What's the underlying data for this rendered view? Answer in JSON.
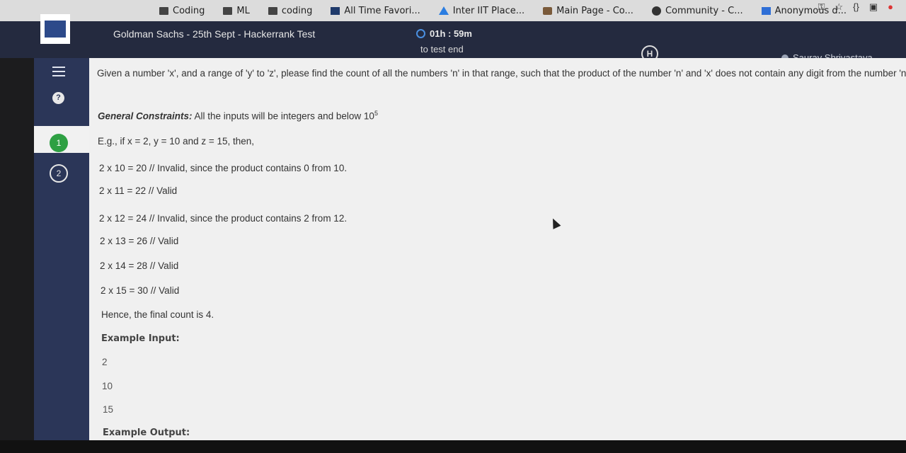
{
  "bookmarks": [
    {
      "label": "Coding",
      "icon": "folder-icon"
    },
    {
      "label": "ML",
      "icon": "folder-icon"
    },
    {
      "label": "coding",
      "icon": "folder-icon"
    },
    {
      "label": "All Time Favori...",
      "icon": "document-icon"
    },
    {
      "label": "Inter IIT Place...",
      "icon": "drive-icon"
    },
    {
      "label": "Main Page - Co...",
      "icon": "mug-icon"
    },
    {
      "label": "Community - C...",
      "icon": "circle-icon"
    },
    {
      "label": "Anonymous d...",
      "icon": "form-icon"
    }
  ],
  "header": {
    "test_title": "Goldman Sachs - 25th Sept - Hackerrank Test",
    "timer_value": "01h : 59m",
    "timer_sub": "to test end",
    "user_name": "Saurav Shrivastava",
    "hr_logo": "H"
  },
  "sidebar": {
    "help": "?",
    "questions": [
      "1",
      "2"
    ]
  },
  "content": {
    "problem": "Given a number 'x', and a range of 'y' to 'z', please find the count of all the numbers 'n' in that range, such that the product of the number 'n' and 'x' does not contain any digit from the number 'n'.",
    "constraints_label": "General Constraints:",
    "constraints_text": " All the inputs will be integers and below 10",
    "constraints_exp": "5",
    "example_intro": "E.g., if x = 2, y = 10 and z = 15, then,",
    "lines": [
      "2 x 10 = 20 // Invalid, since the product contains 0 from 10.",
      "2 x 11 = 22 // Valid",
      "2 x 12 = 24 // Invalid, since the product contains 2 from 12.",
      "2 x 13 = 26 // Valid",
      "2 x 14 = 28 // Valid",
      "2 x 15 = 30 // Valid"
    ],
    "final_count": "Hence, the final count is 4.",
    "example_input_label": "Example Input:",
    "example_input": [
      "2",
      "10",
      "15"
    ],
    "example_output_label": "Example Output:"
  }
}
